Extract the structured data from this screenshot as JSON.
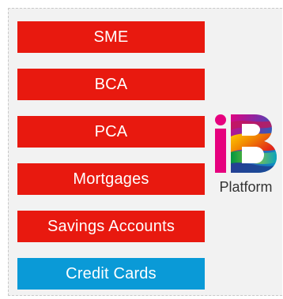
{
  "menu": {
    "items": [
      {
        "label": "SME",
        "color": "#e8190f"
      },
      {
        "label": "BCA",
        "color": "#e8190f"
      },
      {
        "label": "PCA",
        "color": "#e8190f"
      },
      {
        "label": "Mortgages",
        "color": "#e8190f"
      },
      {
        "label": "Savings Accounts",
        "color": "#e8190f"
      },
      {
        "label": "Credit Cards",
        "color": "#0a9ad7"
      }
    ]
  },
  "logo": {
    "icon": "ib-platform-logo",
    "caption": "Platform"
  }
}
